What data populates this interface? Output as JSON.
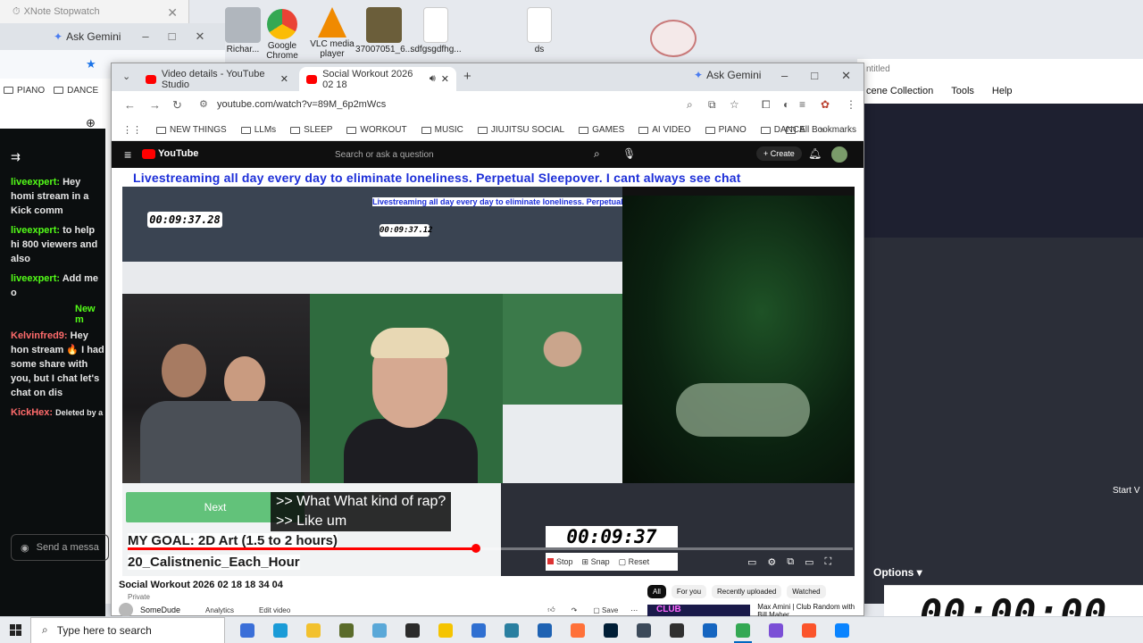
{
  "stopwatch_window": {
    "title": "XNote Stopwatch"
  },
  "desktop_icons": [
    {
      "label": "Richar...",
      "color": "#b0b6bd"
    },
    {
      "label": "Google Chrome",
      "color": "#34a853"
    },
    {
      "label": "VLC media player",
      "color": "#f08a00"
    },
    {
      "label": "37007051_6...",
      "color": "#6b5e3a"
    },
    {
      "label": "sdfgsgdfhg...",
      "color": "#ffffff"
    },
    {
      "label": "ds",
      "color": "#ffffff"
    }
  ],
  "left_browser": {
    "gemini_label": "Ask Gemini",
    "bookmarks": [
      "PIANO",
      "DANCE"
    ],
    "chat_messages": [
      {
        "user": "liveexpert:",
        "text": "Hey homi stream in a Kick comm"
      },
      {
        "user": "liveexpert:",
        "text": "to help hi 800 viewers and also"
      },
      {
        "user": "liveexpert:",
        "text": "Add me o"
      },
      {
        "user": "Kelvinfred9:",
        "text": "Hey hon stream 🔥 I had some share with you, but I chat let's chat on dis"
      },
      {
        "user": "KickHex:",
        "text": "Deleted by a"
      }
    ],
    "new_label": "New m",
    "send_placeholder": "Send a messa"
  },
  "obs": {
    "title_fragment": "ntitled",
    "menu": [
      "cene Collection",
      "Tools",
      "Help"
    ],
    "options_label": "Options",
    "clock": "00:00:00",
    "start_label": "Start V"
  },
  "main_browser": {
    "tabs": [
      {
        "label": "Video details - YouTube Studio",
        "active": false
      },
      {
        "label": "Social Workout 2026 02 18",
        "active": true
      }
    ],
    "gemini_label": "Ask Gemini",
    "url": "youtube.com/watch?v=89M_6p2mWcs",
    "bookmarks": [
      "NEW THINGS",
      "LLMs",
      "SLEEP",
      "WORKOUT",
      "MUSIC",
      "JIUJITSU SOCIAL",
      "GAMES",
      "AI VIDEO",
      "PIANO",
      "DANCE"
    ],
    "all_bookmarks": "All Bookmarks"
  },
  "youtube": {
    "logo": "YouTube",
    "search_placeholder": "Search or ask a question",
    "create_label": "Create",
    "video": {
      "banner": "Livestreaming all day every day to eliminate loneliness. Perpetual Sleepover. I cant always see chat",
      "mini_clock_1": "00:09:37.28",
      "mini_clock_2": "00:09:37.12",
      "next_label": "Next",
      "captions": [
        ">> What What kind of rap?",
        ">> Like um"
      ],
      "goal_line_1": "MY GOAL: 2D Art (1.5 to 2 hours)",
      "goal_line_2": "20_Calistnenic_Each_Hour",
      "timer": "00:09:37",
      "stop_label": "Stop",
      "snap_label": "Snap",
      "reset_label": "Reset",
      "progress_fraction": 0.48
    },
    "video_title": "Social Workout 2026 02 18 18 34 04",
    "privacy": "Private",
    "channel": "SomeDude",
    "analytics": "Analytics",
    "edit_video": "Edit video",
    "save_label": "Save",
    "filters": [
      {
        "label": "All",
        "on": true
      },
      {
        "label": "For you",
        "on": false
      },
      {
        "label": "Recently uploaded",
        "on": false
      },
      {
        "label": "Watched",
        "on": false
      }
    ],
    "rec_title": "Max Amini | Club Random with Bill Maher",
    "rec_thumb_text": "CLUB"
  },
  "taskbar": {
    "search_placeholder": "Type here to search",
    "apps": [
      {
        "name": "task-view-icon",
        "color": "#3b6fd8"
      },
      {
        "name": "edge-icon",
        "color": "#1a9bd7"
      },
      {
        "name": "file-explorer-icon",
        "color": "#f2c12e"
      },
      {
        "name": "app-clock-icon",
        "color": "#5a6b2a"
      },
      {
        "name": "notepad-icon",
        "color": "#5aa8d8"
      },
      {
        "name": "app-circle-icon",
        "color": "#2b2b2b"
      },
      {
        "name": "lightbulb-icon",
        "color": "#f5c400"
      },
      {
        "name": "docs-icon",
        "color": "#2f6fd1"
      },
      {
        "name": "gear-app-icon",
        "color": "#2a7fa0"
      },
      {
        "name": "network-icon",
        "color": "#1e62b3"
      },
      {
        "name": "firefox-icon",
        "color": "#ff7139"
      },
      {
        "name": "photoshop-icon",
        "color": "#001e36"
      },
      {
        "name": "davinci-icon",
        "color": "#3c4a5a"
      },
      {
        "name": "obs-icon",
        "color": "#303030"
      },
      {
        "name": "window-icon",
        "color": "#1565c0"
      },
      {
        "name": "chrome-icon",
        "color": "#34a853"
      },
      {
        "name": "vpn-icon",
        "color": "#7b4fd6"
      },
      {
        "name": "brave-icon",
        "color": "#fb542b"
      },
      {
        "name": "stopwatch-app-icon",
        "color": "#0a84ff"
      }
    ]
  }
}
